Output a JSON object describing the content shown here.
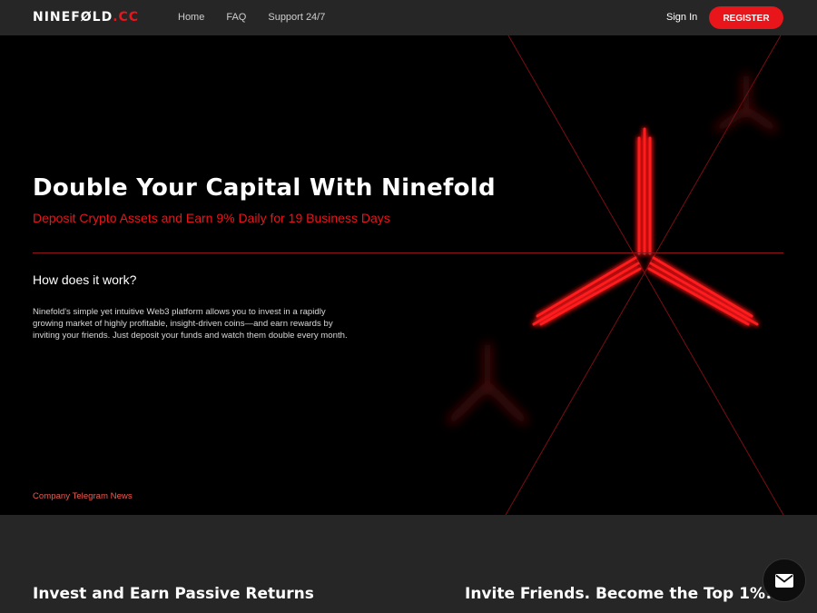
{
  "nav": {
    "logo_main": "NINEFØLD",
    "logo_tld": ".CC",
    "links": [
      "Home",
      "FAQ",
      "Support 24/7"
    ],
    "signin": "Sign In",
    "register": "REGISTER"
  },
  "hero": {
    "title": "Double Your Capital With Ninefold",
    "subtitle": "Deposit Crypto Assets and Earn 9% Daily for 19 Business Days",
    "how_heading": "How does it work?",
    "how_body": "Ninefold's simple yet intuitive Web3 platform allows you to invest in a rapidly growing market of highly profitable, insight-driven coins—and earn rewards by inviting your friends. Just deposit your funds and watch them double every month.",
    "news_link": "Company Telegram News"
  },
  "sections": {
    "left_heading": "Invest and Earn Passive Returns",
    "right_heading": "Invite Friends. Become the Top 1%!"
  },
  "colors": {
    "accent": "#e8151b",
    "nav_bg": "#262626",
    "hero_bg": "#000000"
  },
  "icons": {
    "chat": "mail-icon"
  }
}
